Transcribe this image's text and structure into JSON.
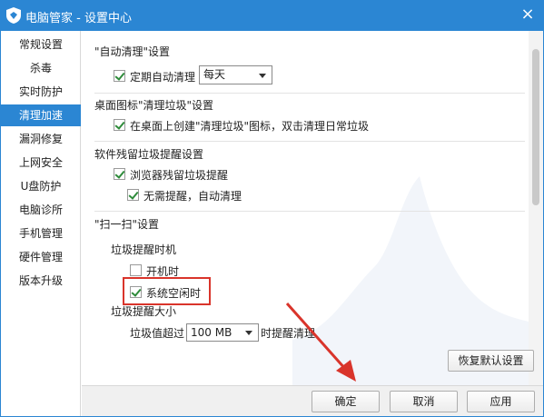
{
  "window": {
    "title": "电脑管家 - 设置中心",
    "close_glyph": "×",
    "accent": "#2b86d3"
  },
  "sidebar": {
    "items": [
      {
        "label": "常规设置",
        "active": false
      },
      {
        "label": "杀毒",
        "active": false
      },
      {
        "label": "实时防护",
        "active": false
      },
      {
        "label": "清理加速",
        "active": true
      },
      {
        "label": "漏洞修复",
        "active": false
      },
      {
        "label": "上网安全",
        "active": false
      },
      {
        "label": "U盘防护",
        "active": false
      },
      {
        "label": "电脑诊所",
        "active": false
      },
      {
        "label": "手机管理",
        "active": false
      },
      {
        "label": "硬件管理",
        "active": false
      },
      {
        "label": "版本升级",
        "active": false
      }
    ]
  },
  "auto_clean": {
    "title": "\"自动清理\"设置",
    "periodic_label": "定期自动清理",
    "periodic_checked": true,
    "period_value": "每天"
  },
  "desktop_icon": {
    "title": "桌面图标\"清理垃圾\"设置",
    "create_label": "在桌面上创建\"清理垃圾\"图标，双击清理日常垃圾",
    "create_checked": true
  },
  "residual": {
    "title": "软件残留垃圾提醒设置",
    "browser_label": "浏览器残留垃圾提醒",
    "browser_checked": true,
    "no_remind_label": "无需提醒，自动清理",
    "no_remind_checked": true
  },
  "scan": {
    "title": "\"扫一扫\"设置",
    "timing_heading": "垃圾提醒时机",
    "on_boot_label": "开机时",
    "on_boot_checked": false,
    "idle_label": "系统空闲时",
    "idle_checked": true,
    "size_heading": "垃圾提醒大小",
    "threshold_prefix": "垃圾值超过",
    "threshold_value": "100 MB",
    "threshold_suffix": "时提醒清理"
  },
  "buttons": {
    "restore": "恢复默认设置",
    "ok": "确定",
    "cancel": "取消",
    "apply": "应用"
  },
  "annotation_color": "#d9342b"
}
